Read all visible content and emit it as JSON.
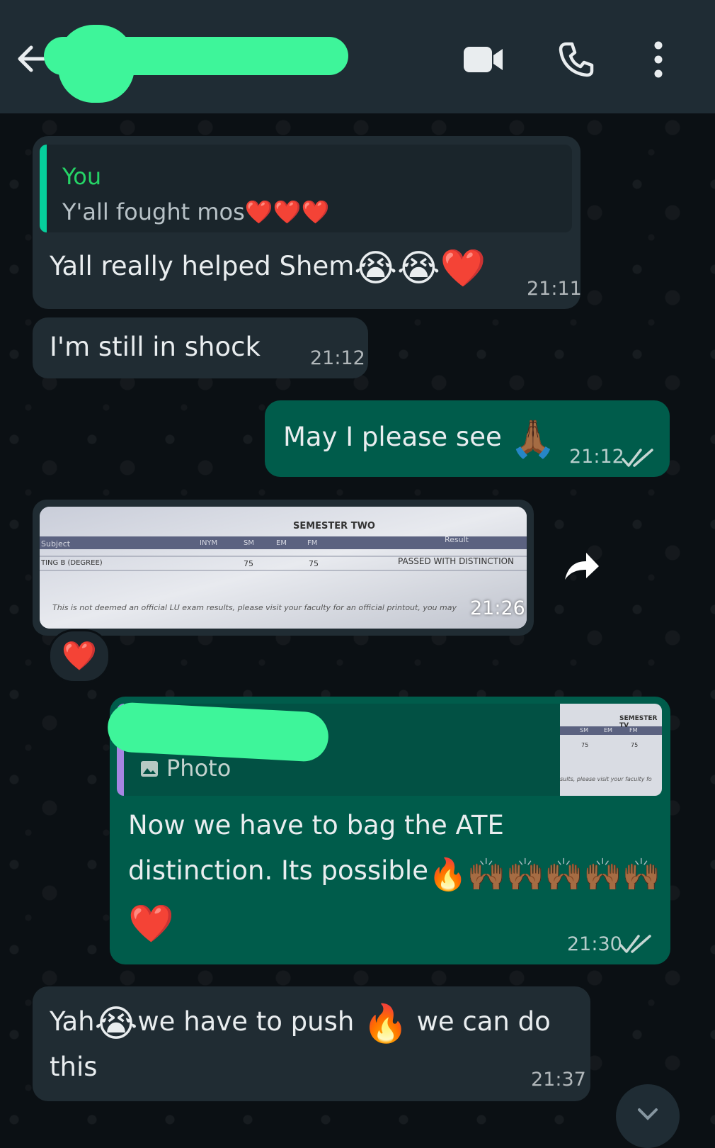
{
  "header": {
    "back_icon": "arrow-left-icon",
    "icons": [
      "video-call-icon",
      "phone-icon",
      "more-vert-icon"
    ]
  },
  "colors": {
    "header_bg": "#1f2c34",
    "incoming_bg": "#202c33",
    "outgoing_bg": "#005c4b",
    "accent_green": "#25d366",
    "redaction": "#3ef59a"
  },
  "messages": [
    {
      "direction": "incoming",
      "quote_author": "You",
      "quote_text": "Y'all fought mos",
      "quote_emoji": "❤️❤️❤️",
      "text": "Yall really helped Shem",
      "emoji": "😭😭❤️",
      "time": "21:11"
    },
    {
      "direction": "incoming",
      "text": "I'm still in shock",
      "time": "21:12"
    },
    {
      "direction": "outgoing",
      "text": "May I please see",
      "emoji": "🙏🏾",
      "time": "21:12",
      "status": "read"
    },
    {
      "direction": "incoming",
      "type": "photo",
      "photo_title": "SEMESTER TWO",
      "photo_headers": [
        "Subject",
        "INYM",
        "SM",
        "EM",
        "FM",
        "Result"
      ],
      "photo_row": [
        "TING B (DEGREE)",
        "75",
        "75",
        "PASSED WITH DISTINCTION"
      ],
      "photo_footer": "This is not deemed an official LU exam results, please visit your faculty for an official printout, you may",
      "time": "21:26",
      "reaction": "❤️",
      "forward_icon": "forward-arrow-icon"
    },
    {
      "direction": "outgoing",
      "quote_label": "Photo",
      "quote_icon": "photo-icon",
      "quote_thumb_title": "SEMESTER TV",
      "quote_thumb_headers": [
        "SM",
        "EM",
        "FM"
      ],
      "quote_thumb_values": [
        "75",
        "75"
      ],
      "quote_thumb_footer": "sults, please visit your faculty fo",
      "line1": "Now we have to bag the ATE",
      "line2": "distinction. Its possible",
      "line2_emoji": "🔥🙌🏾🙌🏾🙌🏾🙌🏾🙌🏾",
      "line3_emoji": "❤️",
      "time": "21:30",
      "status": "read"
    },
    {
      "direction": "incoming",
      "part1": "Yah",
      "emoji1": "😭",
      "part2": "we have to push ",
      "emoji2": "🔥",
      "part3": " we can do",
      "line2": "this",
      "time": "21:37"
    }
  ],
  "scroll_down_icon": "chevron-down-icon"
}
